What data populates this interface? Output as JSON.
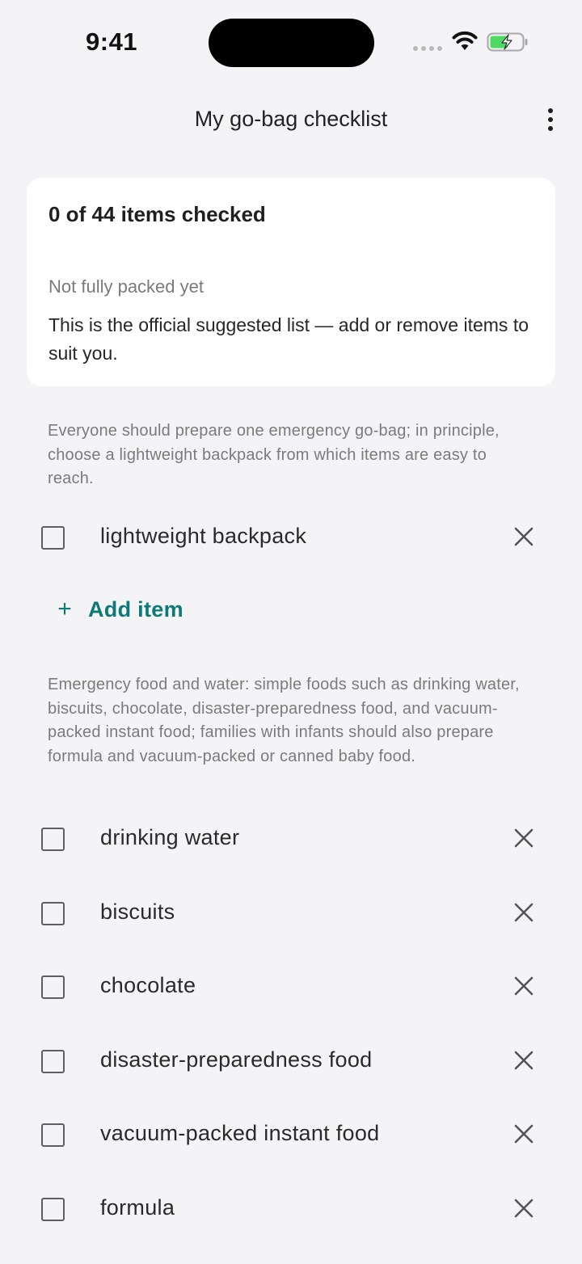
{
  "status_bar": {
    "time": "9:41"
  },
  "header": {
    "title": "My go-bag checklist"
  },
  "summary": {
    "count_text": "0 of 44 items checked",
    "status_text": "Not fully packed yet",
    "note": "This is the official suggested list — add or remove items to suit you."
  },
  "sections": [
    {
      "description": "Everyone should prepare one emergency go-bag; in principle, choose a lightweight backpack from which items are easy to reach.",
      "items": [
        {
          "label": "lightweight backpack",
          "checked": false
        }
      ],
      "add_label": "Add item"
    },
    {
      "description": "Emergency food and water: simple foods such as drinking water, biscuits, chocolate, disaster-preparedness food, and vacuum-packed instant food; families with infants should also prepare formula and vacuum-packed or canned baby food.",
      "items": [
        {
          "label": "drinking water",
          "checked": false
        },
        {
          "label": "biscuits",
          "checked": false
        },
        {
          "label": "chocolate",
          "checked": false
        },
        {
          "label": "disaster-preparedness food",
          "checked": false
        },
        {
          "label": "vacuum-packed instant food",
          "checked": false
        },
        {
          "label": "formula",
          "checked": false
        }
      ]
    }
  ],
  "colors": {
    "accent": "#0d7a78",
    "background": "#f4f4f7",
    "card": "#ffffff"
  },
  "icons": {
    "menu": "more-vertical-icon",
    "remove": "close-icon",
    "add": "plus-icon",
    "checkbox": "checkbox-unchecked"
  }
}
